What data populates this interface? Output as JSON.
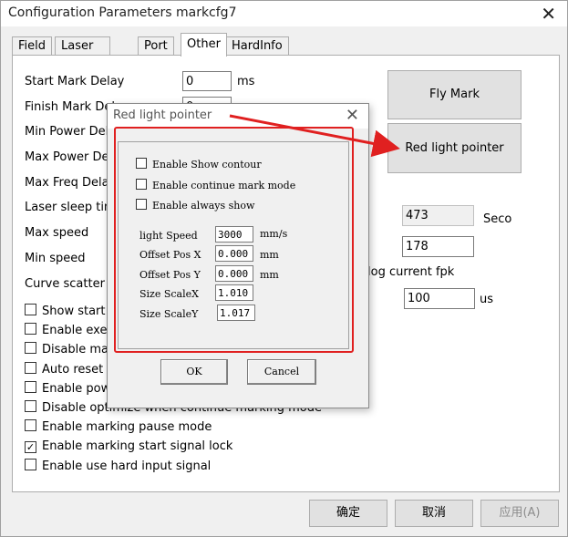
{
  "window": {
    "title": "Configuration Parameters markcfg7",
    "close": "✕"
  },
  "tabs": [
    "Field",
    "Laser Control",
    "Port",
    "Other",
    "HardInfo"
  ],
  "other": {
    "start_mark_delay": {
      "label": "Start Mark Delay",
      "value": "0",
      "unit": "ms"
    },
    "finish_mark_delay": {
      "label": "Finish Mark Delay",
      "value": "0"
    },
    "min_power_delay": {
      "label": "Min Power Delay"
    },
    "max_power_delay": {
      "label": "Max Power Delay"
    },
    "max_freq_delay": {
      "label": "Max Freq Delay"
    },
    "laser_sleep_time": {
      "label": "Laser sleep time",
      "value": "473",
      "unit": "Seco"
    },
    "max_speed": {
      "label": "Max speed",
      "value": "178"
    },
    "min_speed": {
      "label": "Min speed"
    },
    "curve_scatter": {
      "label": "Curve scatter tol"
    },
    "analog_label": "log current fpk",
    "analog_value": "100",
    "analog_unit": "us",
    "fly_mark_button": "Fly Mark",
    "red_light_button": "Red light pointer",
    "checkboxes": [
      {
        "label": "Show start mark",
        "checked": ""
      },
      {
        "label": "Enable execute",
        "checked": ""
      },
      {
        "label": "Disable mark",
        "checked": ""
      },
      {
        "label": "Auto reset mark",
        "checked": ""
      },
      {
        "label": "Enable power",
        "checked": ""
      },
      {
        "label": "Disable optimize when continue marking mode",
        "checked": ""
      },
      {
        "label": "Enable marking pause mode",
        "checked": ""
      },
      {
        "label": "Enable marking start signal lock",
        "checked": "✓"
      },
      {
        "label": "Enable use hard input signal",
        "checked": ""
      }
    ]
  },
  "footer": {
    "ok": "确定",
    "cancel": "取消",
    "apply": "应用(A)"
  },
  "popup": {
    "title": "Red light pointer",
    "close": "✕",
    "checkboxes": [
      "Enable Show contour",
      "Enable continue mark mode",
      "Enable always show"
    ],
    "light_speed": {
      "label": "light Speed",
      "value": "3000",
      "unit": "mm/s"
    },
    "offset_x": {
      "label": "Offset Pos X",
      "value": "0.000",
      "unit": "mm"
    },
    "offset_y": {
      "label": "Offset Pos Y",
      "value": "0.000",
      "unit": "mm"
    },
    "scale_x": {
      "label": "Size ScaleX",
      "value": "1.010"
    },
    "scale_y": {
      "label": "Size ScaleY",
      "value": "1.017"
    },
    "ok": "OK",
    "cancel": "Cancel"
  },
  "colors": {
    "annotation": "#e02020"
  }
}
